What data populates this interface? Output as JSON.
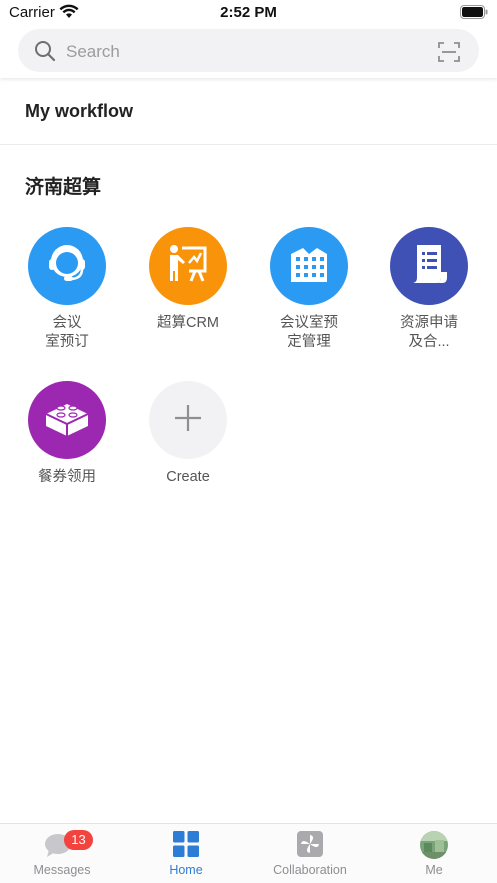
{
  "status_bar": {
    "carrier": "Carrier",
    "time": "2:52 PM"
  },
  "search": {
    "placeholder": "Search",
    "icon": "search-icon",
    "scan_icon": "scan-icon"
  },
  "workflow": {
    "title": "My workflow"
  },
  "section": {
    "title": "济南超算",
    "apps": [
      {
        "label_line1": "会议",
        "label_line2": "室预订",
        "color": "#2b9af3",
        "icon": "headset-icon"
      },
      {
        "label_line1": "超算CRM",
        "label_line2": "",
        "color": "#f9940a",
        "icon": "presentation-icon"
      },
      {
        "label_line1": "会议室预",
        "label_line2": "定管理",
        "color": "#2b9af3",
        "icon": "building-icon"
      },
      {
        "label_line1": "资源申请",
        "label_line2": "及合...",
        "color": "#3f51b5",
        "icon": "document-icon"
      },
      {
        "label_line1": "餐券领用",
        "label_line2": "",
        "color": "#9c27b0",
        "icon": "brick-icon"
      },
      {
        "label_line1": "Create",
        "label_line2": "",
        "color": "#f2f2f4",
        "icon": "plus-icon"
      }
    ]
  },
  "tab_bar": {
    "tabs": [
      {
        "label": "Messages",
        "icon": "chat-icon",
        "badge": "13"
      },
      {
        "label": "Home",
        "icon": "grid-icon",
        "active": true
      },
      {
        "label": "Collaboration",
        "icon": "pinwheel-icon"
      },
      {
        "label": "Me",
        "icon": "avatar-icon"
      }
    ]
  },
  "colors": {
    "accent": "#2d7dd6",
    "badge": "#f2433e"
  }
}
